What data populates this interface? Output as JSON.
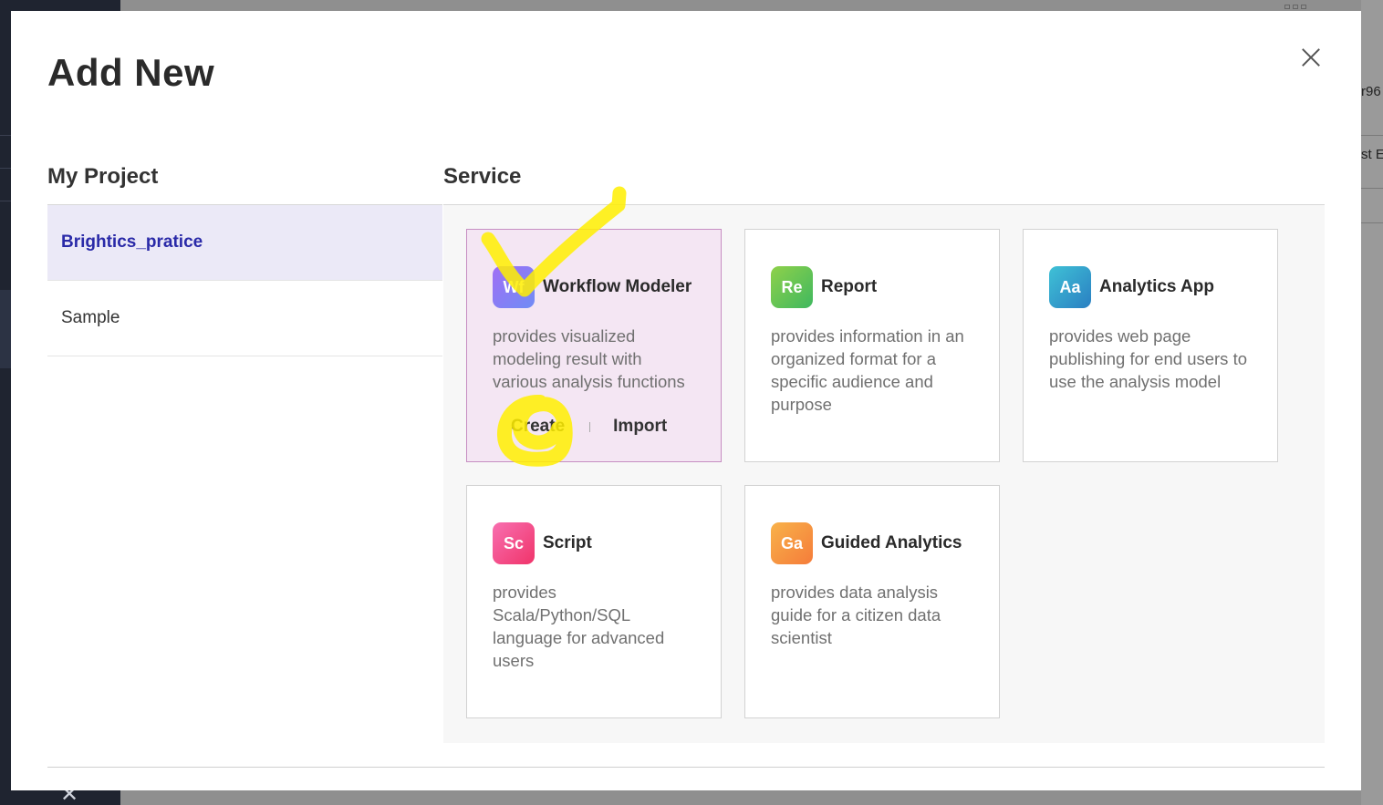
{
  "background": {
    "right_texts": [
      "r96",
      "st E"
    ]
  },
  "modal": {
    "title": "Add New",
    "my_project": {
      "heading": "My Project",
      "items": [
        {
          "label": "Brightics_pratice",
          "selected": true
        },
        {
          "label": "Sample",
          "selected": false
        }
      ]
    },
    "service": {
      "heading": "Service",
      "cards": [
        {
          "abbr": "Wf",
          "name": "Workflow Modeler",
          "description": "provides visualized modeling result with various analysis functions",
          "create": "Create",
          "import": "Import",
          "active": true,
          "icon_color": "#8f7df0"
        },
        {
          "abbr": "Re",
          "name": "Report",
          "description": "provides information in an organized format for a specific audience and purpose",
          "active": false,
          "icon_color": "#6cc24a"
        },
        {
          "abbr": "Aa",
          "name": "Analytics App",
          "description": "provides web page publishing for end users to use the analysis model",
          "active": false,
          "icon_color": "#2aa6c2"
        },
        {
          "abbr": "Sc",
          "name": "Script",
          "description": "provides Scala/Python/SQL language for advanced users",
          "active": false,
          "icon_color": "#f0468a"
        },
        {
          "abbr": "Ga",
          "name": "Guided Analytics",
          "description": "provides data analysis guide for a citizen data scientist",
          "active": false,
          "icon_color": "#f59a3c"
        }
      ]
    }
  },
  "colors": {
    "selected_project_bg": "#ebe9f7",
    "selected_project_text": "#2a2aa8",
    "active_card_bg": "#f4e6f3",
    "highlighter": "#ffee00"
  }
}
